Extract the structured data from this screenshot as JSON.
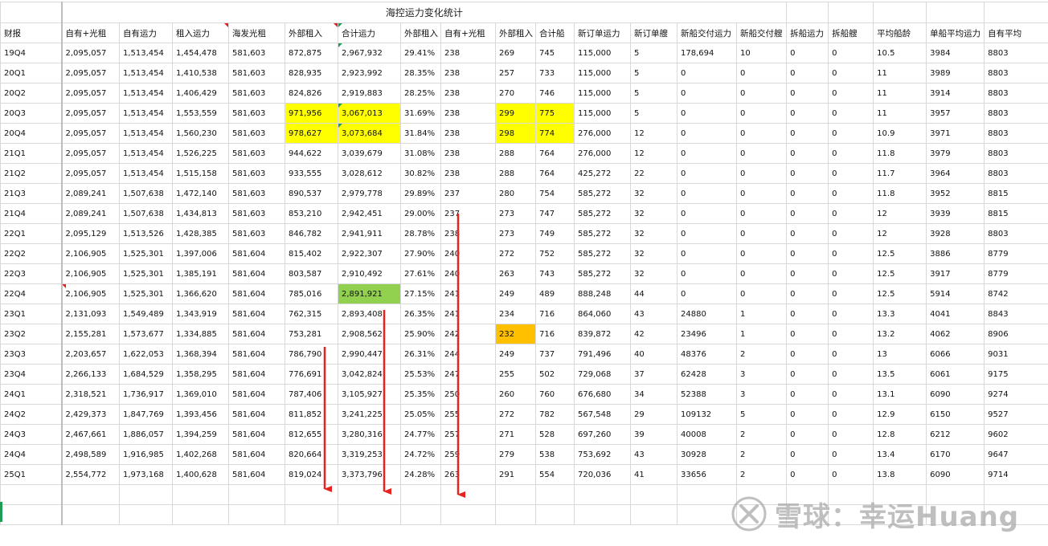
{
  "title": "海控运力变化统计",
  "headers": [
    "财报",
    "自有+光租",
    "自有运力",
    "租入运力",
    "海发光租",
    "外部租入",
    "合计运力",
    "外部租入",
    "自有+光租",
    "外部租入",
    "合计船",
    "新订单运力",
    "新订单艘",
    "新船交付运力",
    "新船交付艘",
    "拆船运力",
    "拆船艘",
    "平均船龄",
    "单船平均运力",
    "自有平均"
  ],
  "rows": [
    [
      "19Q4",
      "2,095,057",
      "1,513,454",
      "1,454,478",
      "581,603",
      "872,875",
      "2,967,932",
      "29.41%",
      "238",
      "269",
      "745",
      "115,000",
      "5",
      "178,694",
      "10",
      "0",
      "0",
      "10.5",
      "3984",
      "8803"
    ],
    [
      "20Q1",
      "2,095,057",
      "1,513,454",
      "1,410,538",
      "581,603",
      "828,935",
      "2,923,992",
      "28.35%",
      "238",
      "257",
      "733",
      "115,000",
      "5",
      "0",
      "0",
      "0",
      "0",
      "11",
      "3989",
      "8803"
    ],
    [
      "20Q2",
      "2,095,057",
      "1,513,454",
      "1,406,429",
      "581,603",
      "824,826",
      "2,919,883",
      "28.25%",
      "238",
      "270",
      "746",
      "115,000",
      "5",
      "0",
      "0",
      "0",
      "0",
      "11",
      "3914",
      "8803"
    ],
    [
      "20Q3",
      "2,095,057",
      "1,513,454",
      "1,553,559",
      "581,603",
      "971,956",
      "3,067,013",
      "31.69%",
      "238",
      "299",
      "775",
      "115,000",
      "5",
      "0",
      "0",
      "0",
      "0",
      "11",
      "3957",
      "8803"
    ],
    [
      "20Q4",
      "2,095,057",
      "1,513,454",
      "1,560,230",
      "581,603",
      "978,627",
      "3,073,684",
      "31.84%",
      "238",
      "298",
      "774",
      "276,000",
      "12",
      "0",
      "0",
      "0",
      "0",
      "10.9",
      "3971",
      "8803"
    ],
    [
      "21Q1",
      "2,095,057",
      "1,513,454",
      "1,526,225",
      "581,603",
      "944,622",
      "3,039,679",
      "31.08%",
      "238",
      "288",
      "764",
      "276,000",
      "12",
      "0",
      "0",
      "0",
      "0",
      "11.8",
      "3979",
      "8803"
    ],
    [
      "21Q2",
      "2,095,057",
      "1,513,454",
      "1,515,158",
      "581,603",
      "933,555",
      "3,028,612",
      "30.82%",
      "238",
      "288",
      "764",
      "425,272",
      "22",
      "0",
      "0",
      "0",
      "0",
      "11.7",
      "3964",
      "8803"
    ],
    [
      "21Q3",
      "2,089,241",
      "1,507,638",
      "1,472,140",
      "581,603",
      "890,537",
      "2,979,778",
      "29.89%",
      "237",
      "280",
      "754",
      "585,272",
      "32",
      "0",
      "0",
      "0",
      "0",
      "11.8",
      "3952",
      "8815"
    ],
    [
      "21Q4",
      "2,089,241",
      "1,507,638",
      "1,434,813",
      "581,603",
      "853,210",
      "2,942,451",
      "29.00%",
      "237",
      "273",
      "747",
      "585,272",
      "32",
      "0",
      "0",
      "0",
      "0",
      "12",
      "3939",
      "8815"
    ],
    [
      "22Q1",
      "2,095,129",
      "1,513,526",
      "1,428,385",
      "581,603",
      "846,782",
      "2,941,911",
      "28.78%",
      "238",
      "273",
      "749",
      "585,272",
      "32",
      "0",
      "0",
      "0",
      "0",
      "12",
      "3928",
      "8803"
    ],
    [
      "22Q2",
      "2,106,905",
      "1,525,301",
      "1,397,006",
      "581,604",
      "815,402",
      "2,922,307",
      "27.90%",
      "240",
      "272",
      "752",
      "585,272",
      "32",
      "0",
      "0",
      "0",
      "0",
      "12.5",
      "3886",
      "8779"
    ],
    [
      "22Q3",
      "2,106,905",
      "1,525,301",
      "1,385,191",
      "581,604",
      "803,587",
      "2,910,492",
      "27.61%",
      "240",
      "263",
      "743",
      "585,272",
      "32",
      "0",
      "0",
      "0",
      "0",
      "12.5",
      "3917",
      "8779"
    ],
    [
      "22Q4",
      "2,106,905",
      "1,525,301",
      "1,366,620",
      "581,604",
      "785,016",
      "2,891,921",
      "27.15%",
      "241",
      "249",
      "489",
      "888,248",
      "44",
      "0",
      "0",
      "0",
      "0",
      "12.5",
      "5914",
      "8742"
    ],
    [
      "23Q1",
      "2,131,093",
      "1,549,489",
      "1,343,919",
      "581,604",
      "762,315",
      "2,893,408",
      "26.35%",
      "241",
      "234",
      "716",
      "864,060",
      "43",
      "24880",
      "1",
      "0",
      "0",
      "13.3",
      "4041",
      "8843"
    ],
    [
      "23Q2",
      "2,155,281",
      "1,573,677",
      "1,334,885",
      "581,604",
      "753,281",
      "2,908,562",
      "25.90%",
      "242",
      "232",
      "716",
      "839,872",
      "42",
      "23496",
      "1",
      "0",
      "0",
      "13.2",
      "4062",
      "8906"
    ],
    [
      "23Q3",
      "2,203,657",
      "1,622,053",
      "1,368,394",
      "581,604",
      "786,790",
      "2,990,447",
      "26.31%",
      "244",
      "249",
      "737",
      "791,496",
      "40",
      "48376",
      "2",
      "0",
      "0",
      "13",
      "6066",
      "9031"
    ],
    [
      "23Q4",
      "2,266,133",
      "1,684,529",
      "1,358,295",
      "581,604",
      "776,691",
      "3,042,824",
      "25.53%",
      "247",
      "255",
      "502",
      "729,068",
      "37",
      "62428",
      "3",
      "0",
      "0",
      "13.5",
      "6061",
      "9175"
    ],
    [
      "24Q1",
      "2,318,521",
      "1,736,917",
      "1,369,010",
      "581,604",
      "787,406",
      "3,105,927",
      "25.35%",
      "250",
      "260",
      "760",
      "676,680",
      "34",
      "52388",
      "3",
      "0",
      "0",
      "13.1",
      "6090",
      "9274"
    ],
    [
      "24Q2",
      "2,429,373",
      "1,847,769",
      "1,393,456",
      "581,604",
      "811,852",
      "3,241,225",
      "25.05%",
      "255",
      "272",
      "782",
      "567,548",
      "29",
      "109132",
      "5",
      "0",
      "0",
      "12.9",
      "6150",
      "9527"
    ],
    [
      "24Q3",
      "2,467,661",
      "1,886,057",
      "1,394,259",
      "581,604",
      "812,655",
      "3,280,316",
      "24.77%",
      "257",
      "271",
      "528",
      "697,260",
      "39",
      "40008",
      "2",
      "0",
      "0",
      "12.8",
      "6212",
      "9602"
    ],
    [
      "24Q4",
      "2,498,589",
      "1,916,985",
      "1,402,268",
      "581,604",
      "820,664",
      "3,319,253",
      "24.72%",
      "259",
      "279",
      "538",
      "753,692",
      "43",
      "30928",
      "2",
      "0",
      "0",
      "13.4",
      "6170",
      "9647"
    ],
    [
      "25Q1",
      "2,554,772",
      "1,973,168",
      "1,400,628",
      "581,604",
      "819,024",
      "3,373,796",
      "24.28%",
      "263",
      "291",
      "554",
      "720,036",
      "41",
      "33656",
      "2",
      "0",
      "0",
      "13.8",
      "6090",
      "9714"
    ]
  ],
  "highlights": {
    "yellow": [
      "3-5",
      "3-6",
      "3-9",
      "3-10",
      "4-5",
      "4-6",
      "4-9",
      "4-10"
    ],
    "green": [
      "12-6"
    ],
    "orange": [
      "14-9"
    ]
  },
  "comment_marks": {
    "red_top_right": [
      "h-3",
      "h-5"
    ],
    "red_top_left": [
      "12-1"
    ],
    "green_top_left": [
      "h-6",
      "0-6",
      "3-6",
      "4-6"
    ]
  },
  "arrow_color": "#e8231f",
  "watermark": {
    "text": "雪球：幸运Huang",
    "logo_icon": "snowball-logo-icon"
  }
}
